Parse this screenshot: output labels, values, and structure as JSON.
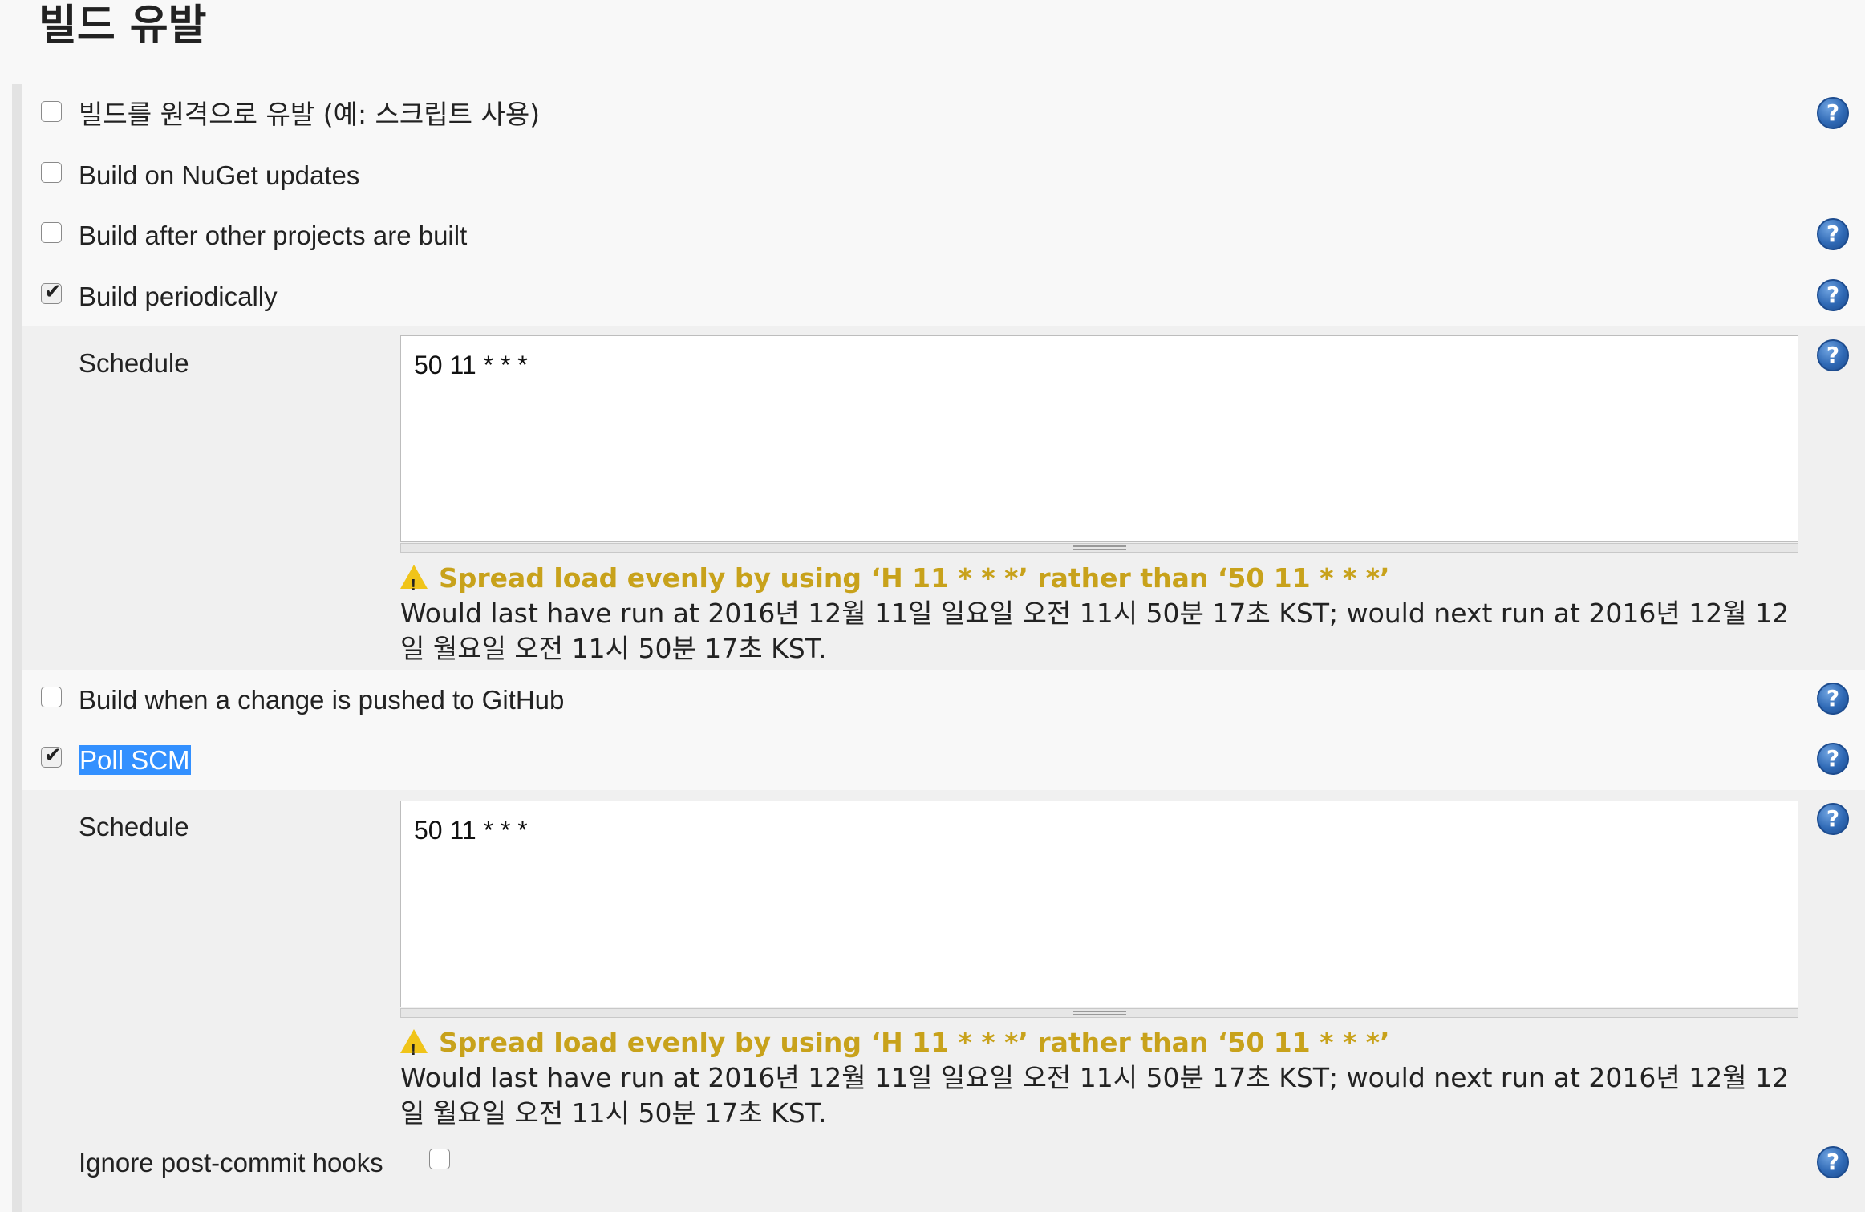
{
  "section": {
    "title": "빌드 유발"
  },
  "triggers": [
    {
      "label": "빌드를 원격으로 유발 (예: 스크립트 사용)",
      "checked": false,
      "help": "?"
    },
    {
      "label": "Build on NuGet updates",
      "checked": false
    },
    {
      "label": "Build after other projects are built",
      "checked": false,
      "help": "?"
    },
    {
      "label": "Build periodically",
      "checked": true,
      "help": "?"
    },
    {
      "label": "Build when a change is pushed to GitHub",
      "checked": false,
      "help": "?"
    },
    {
      "label": "Poll SCM",
      "checked": true,
      "help": "?"
    }
  ],
  "periodic": {
    "schedule_label": "Schedule",
    "schedule_value": "50 11 * * *",
    "warning": "Spread load evenly by using ‘H 11 * * *’ rather than ‘50 11 * * *’",
    "info": "Would last have run at 2016년 12월 11일 일요일 오전 11시 50분 17초 KST; would next run at 2016년 12월 12일 월요일 오전 11시 50분 17초 KST.",
    "help": "?"
  },
  "poll": {
    "schedule_label": "Schedule",
    "schedule_value": "50 11 * * *",
    "warning": "Spread load evenly by using ‘H 11 * * *’ rather than ‘50 11 * * *’",
    "info": "Would last have run at 2016년 12월 11일 일요일 오전 11시 50분 17초 KST; would next run at 2016년 12월 12일 월요일 오전 11시 50분 17초 KST.",
    "help": "?",
    "ignore_hooks_label": "Ignore post-commit hooks",
    "ignore_hooks_checked": false
  },
  "colors": {
    "warning": "#c8a21b",
    "selection": "#3390ff",
    "help_icon": "#2f69b5"
  },
  "icons": {
    "help": "help-icon",
    "warning": "warning-icon",
    "checkbox": "checkbox"
  }
}
